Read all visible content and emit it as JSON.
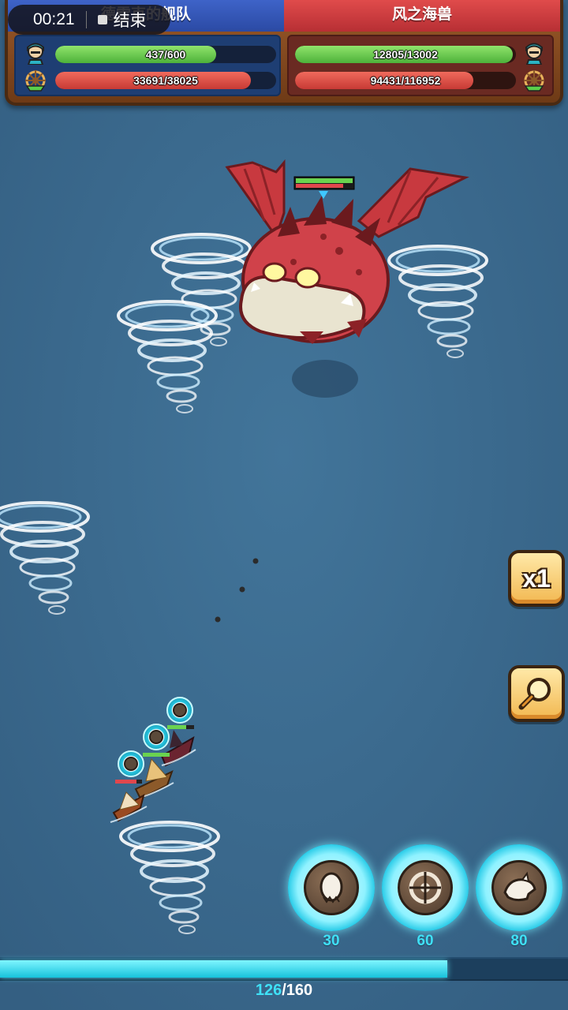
{
  "status": {
    "timer": "00:21",
    "end_label": "结束"
  },
  "player_team": {
    "name": "德雷克的舰队",
    "crew": {
      "current": 437,
      "max": 600,
      "text": "437/600",
      "ratio": 0.728
    },
    "ship": {
      "current": 33691,
      "max": 38025,
      "text": "33691/38025",
      "ratio": 0.886
    },
    "color": "#3e63c8"
  },
  "enemy_team": {
    "name": "风之海兽",
    "crew": {
      "current": 12805,
      "max": 13002,
      "text": "12805/13002",
      "ratio": 0.985
    },
    "ship": {
      "current": 94431,
      "max": 116952,
      "text": "94431/116952",
      "ratio": 0.807
    },
    "color": "#e04b4b"
  },
  "icons": {
    "crew": "pirate-head-icon",
    "ship": "ship-wheel-icon",
    "speed": "x1",
    "zoom": "magnifier-icon"
  },
  "controls": {
    "speed_label": "x1"
  },
  "skills": [
    {
      "name": "egg-skill-icon",
      "cost": "30"
    },
    {
      "name": "wheel-skill-icon",
      "cost": "60"
    },
    {
      "name": "beast-skill-icon",
      "cost": "80"
    }
  ],
  "energy": {
    "current": "126",
    "separator": "/",
    "max": "160",
    "ratio": 0.7875
  },
  "colors": {
    "sea": "#3b6a8e",
    "energy": "#17c2dc",
    "hp_green": "#4db13a",
    "hp_red": "#c73a35"
  }
}
